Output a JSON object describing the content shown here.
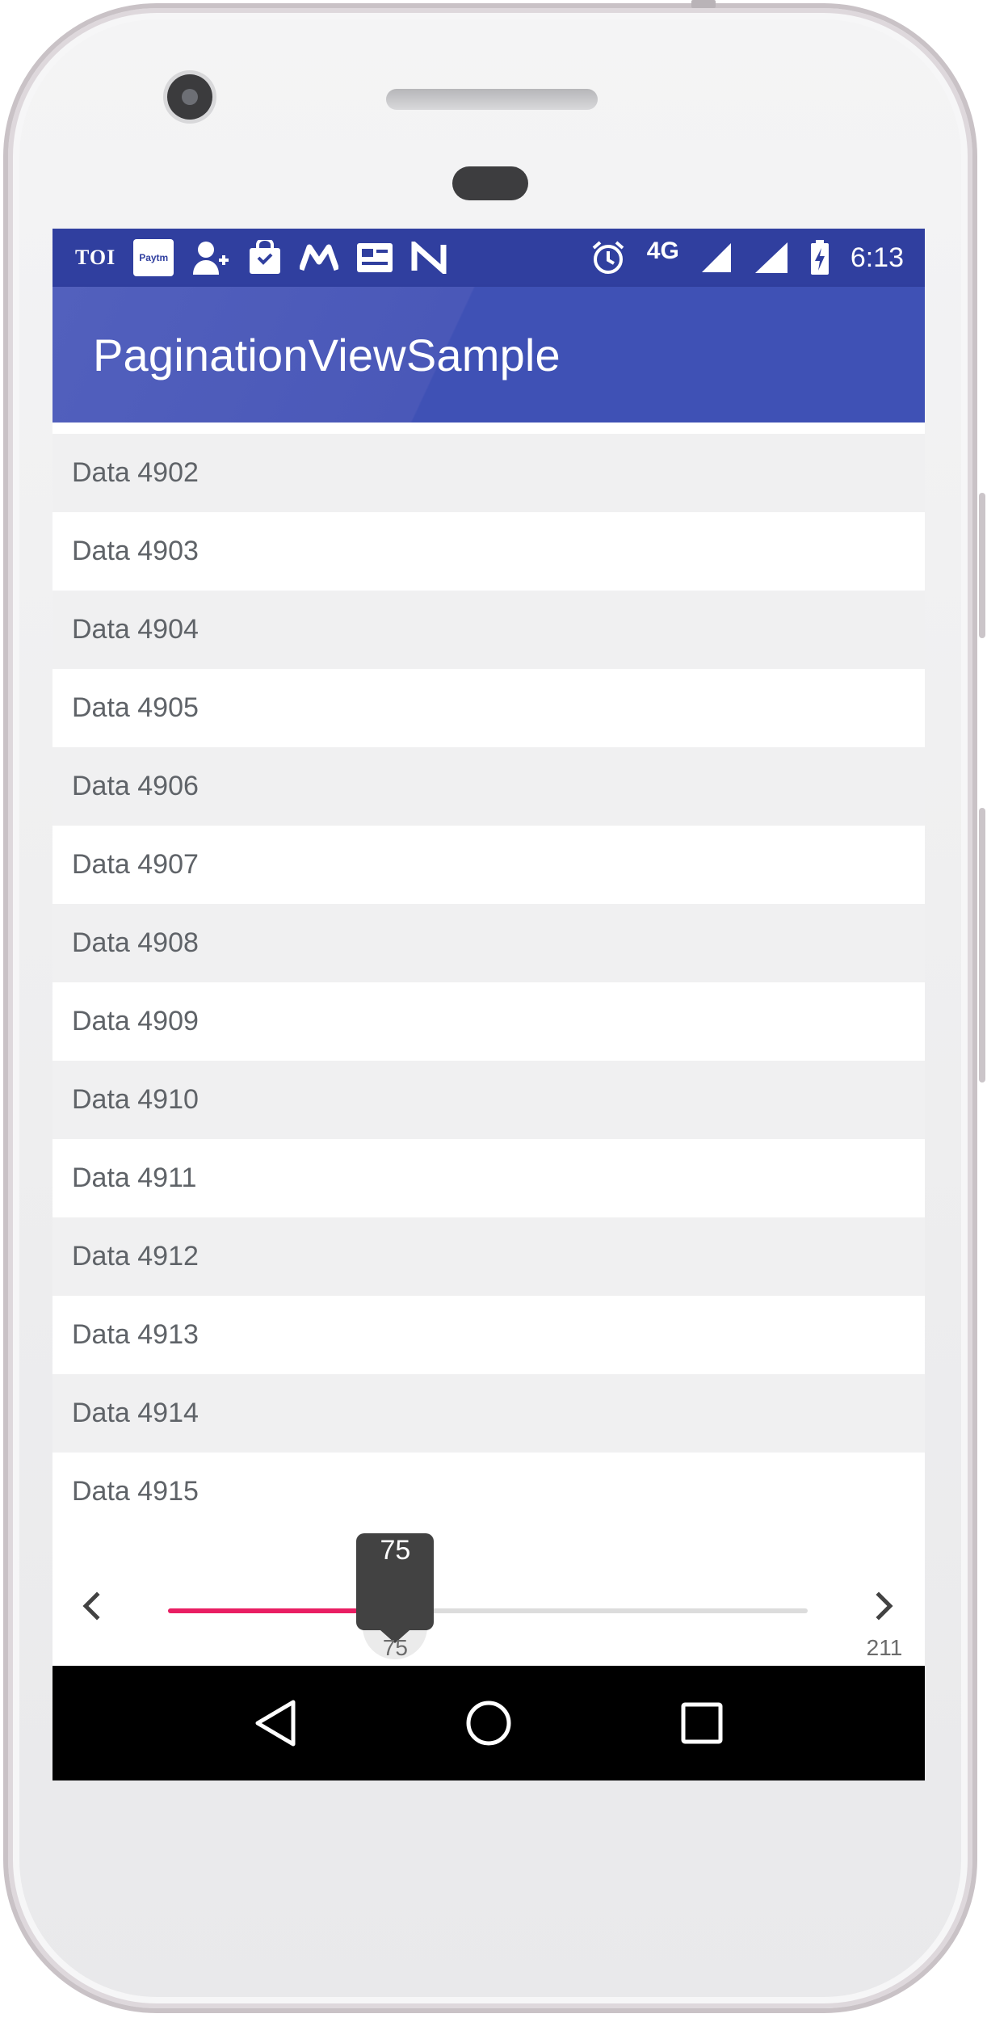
{
  "status_bar": {
    "notification_icons": [
      "toi-icon",
      "paytm-icon",
      "add-contact-icon",
      "shopping-icon",
      "m-icon",
      "news-icon",
      "n-icon"
    ],
    "toi_text": "TOI",
    "paytm_text": "Paytm",
    "network": "4G",
    "time": "6:13"
  },
  "app_bar": {
    "title": "PaginationViewSample",
    "color": "#3f51b5"
  },
  "list": {
    "items": [
      "Data 4902",
      "Data 4903",
      "Data 4904",
      "Data 4905",
      "Data 4906",
      "Data 4907",
      "Data 4908",
      "Data 4909",
      "Data 4910",
      "Data 4911",
      "Data 4912",
      "Data 4913",
      "Data 4914",
      "Data 4915"
    ]
  },
  "pagination": {
    "current_page": 75,
    "current_page_label": "75",
    "bubble_label": "75",
    "total_pages": 211,
    "total_pages_label": "211",
    "accent_color": "#e91e63"
  },
  "nav_bar": {
    "buttons": [
      "back-icon",
      "home-icon",
      "recents-icon"
    ]
  }
}
